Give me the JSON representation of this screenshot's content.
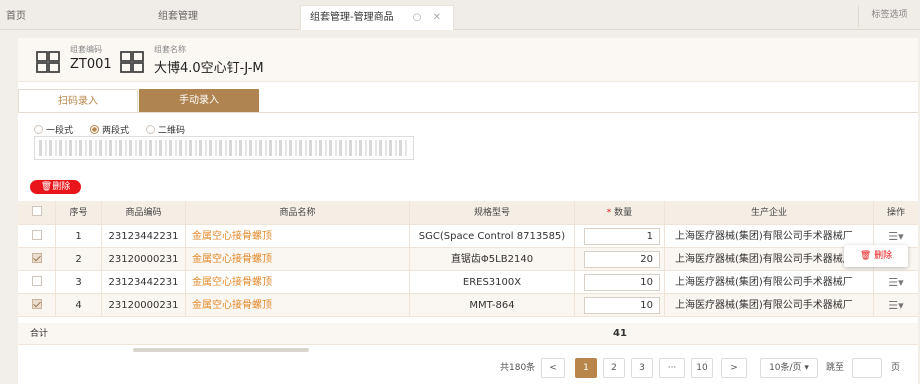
{
  "tabs": {
    "home": "首页",
    "kit_mgmt": "组套管理",
    "active": "组套管理-管理商品",
    "options": "标签选项"
  },
  "header": {
    "code_label": "组套编码",
    "code_value": "ZT001",
    "name_label": "组套名称",
    "name_value": "大博4.0空心钉-J-M"
  },
  "mode_tabs": {
    "scan": "扫码录入",
    "manual": "手动录入"
  },
  "radios": {
    "one": "一段式",
    "two": "两段式",
    "qr": "二维码"
  },
  "delete_button": "删除",
  "table": {
    "headers": {
      "seq": "序号",
      "code": "商品编码",
      "name": "商品名称",
      "spec": "规格型号",
      "qty_req": "*",
      "qty": "数量",
      "mfr": "生产企业",
      "op": "操作"
    },
    "rows": [
      {
        "seq": "1",
        "code": "23123442231",
        "name": "金属空心接骨螺顶",
        "spec": "SGC(Space Control 8713585)",
        "qty": "1",
        "mfr": "上海医疗器械(集团)有限公司手术器械厂",
        "checked": false
      },
      {
        "seq": "2",
        "code": "23120000231",
        "name": "金属空心接骨螺顶",
        "spec": "直锯齿Φ5LB2140",
        "qty": "20",
        "mfr": "上海医疗器械(集团)有限公司手术器械厂",
        "checked": true
      },
      {
        "seq": "3",
        "code": "23123442231",
        "name": "金属空心接骨螺顶",
        "spec": "ERES3100X",
        "qty": "10",
        "mfr": "上海医疗器械(集团)有限公司手术器械厂",
        "checked": false
      },
      {
        "seq": "4",
        "code": "23120000231",
        "name": "金属空心接骨螺顶",
        "spec": "MMT-864",
        "qty": "10",
        "mfr": "上海医疗器械(集团)有限公司手术器械厂",
        "checked": true
      }
    ],
    "sum_label": "合计",
    "sum_value": "41"
  },
  "popup_delete": "删除",
  "pagination": {
    "total": "共180条",
    "pages": [
      "1",
      "2",
      "3",
      "···",
      "10"
    ],
    "prev": "<",
    "next": ">",
    "page_size": "10条/页 ▾",
    "jump_label": "跳至",
    "jump_value": "",
    "page_unit": "页"
  },
  "colors": {
    "accent": "#b8864a",
    "danger": "#e8161a",
    "link": "#e38a2b"
  }
}
